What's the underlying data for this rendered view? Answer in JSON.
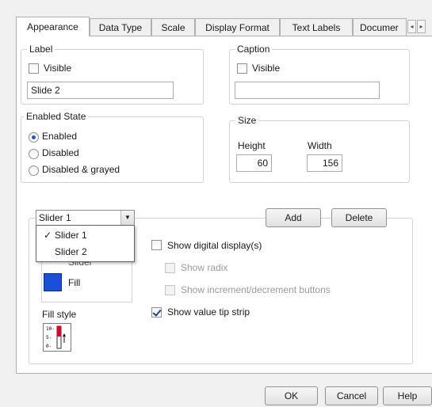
{
  "tabs": [
    {
      "label": "Appearance",
      "active": true
    },
    {
      "label": "Data Type"
    },
    {
      "label": "Scale"
    },
    {
      "label": "Display Format"
    },
    {
      "label": "Text Labels"
    },
    {
      "label": "Documer"
    }
  ],
  "tab_scroll": {
    "left_icon": "chevron-left-icon",
    "right_icon": "chevron-right-icon"
  },
  "label_group": {
    "title": "Label",
    "visible_label": "Visible",
    "visible_checked": false,
    "value": "Slide 2"
  },
  "caption_group": {
    "title": "Caption",
    "visible_label": "Visible",
    "visible_checked": false,
    "value": ""
  },
  "enabled_state": {
    "title": "Enabled State",
    "options": [
      "Enabled",
      "Disabled",
      "Disabled & grayed"
    ],
    "selected": "Enabled"
  },
  "size_group": {
    "title": "Size",
    "height_label": "Height",
    "height_value": "60",
    "width_label": "Width",
    "width_value": "156"
  },
  "slider_select": {
    "selected": "Slider 1",
    "options": [
      "Slider 1",
      "Slider 2"
    ],
    "checked": "Slider 1"
  },
  "slider_buttons": {
    "add": "Add",
    "delete": "Delete"
  },
  "parts": {
    "slider_partial": "Slider",
    "fill_label": "Fill",
    "fill_color": "#1a4fd6"
  },
  "fill_style_label": "Fill style",
  "options": {
    "show_digital": {
      "label": "Show digital display(s)",
      "checked": false
    },
    "show_radix": {
      "label": "Show radix",
      "checked": false,
      "disabled": true
    },
    "show_incdec": {
      "label": "Show increment/decrement buttons",
      "checked": false,
      "disabled": true
    },
    "show_tip": {
      "label": "Show value tip strip",
      "checked": true
    }
  },
  "footer": {
    "ok": "OK",
    "cancel": "Cancel",
    "help": "Help"
  }
}
